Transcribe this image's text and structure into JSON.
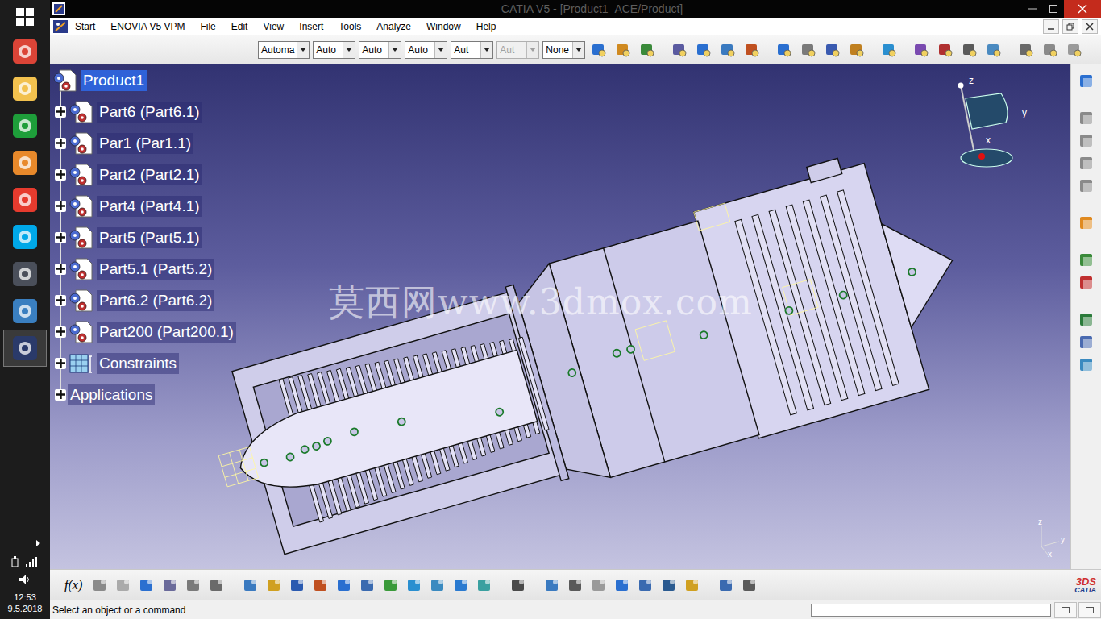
{
  "window": {
    "title": "CATIA V5 - [Product1_ACE/Product]"
  },
  "taskbar": {
    "time": "12:53",
    "date": "9.5.2018"
  },
  "menu": [
    {
      "label": "Start",
      "mnemonic": true
    },
    {
      "label": "ENOVIA V5 VPM",
      "mnemonic": false
    },
    {
      "label": "File",
      "mnemonic": true
    },
    {
      "label": "Edit",
      "mnemonic": true
    },
    {
      "label": "View",
      "mnemonic": true
    },
    {
      "label": "Insert",
      "mnemonic": true
    },
    {
      "label": "Tools",
      "mnemonic": true
    },
    {
      "label": "Analyze",
      "mnemonic": true
    },
    {
      "label": "Window",
      "mnemonic": true
    },
    {
      "label": "Help",
      "mnemonic": true
    }
  ],
  "toolbar": {
    "dropdowns": [
      {
        "value": "Automa",
        "disabled": false
      },
      {
        "value": "Auto",
        "disabled": false
      },
      {
        "value": "Auto",
        "disabled": false
      },
      {
        "value": "Auto",
        "disabled": false
      },
      {
        "value": "Aut",
        "disabled": false
      },
      {
        "value": "Aut",
        "disabled": true
      },
      {
        "value": "None",
        "disabled": false
      }
    ]
  },
  "tree": {
    "items": [
      {
        "label": "Product1",
        "kind": "product",
        "depth": 0,
        "selected": true,
        "expanded": true
      },
      {
        "label": "Part6 (Part6.1)",
        "kind": "part",
        "depth": 1,
        "selected": false,
        "expanded": false
      },
      {
        "label": "Par1 (Par1.1)",
        "kind": "part",
        "depth": 1,
        "selected": false,
        "expanded": false
      },
      {
        "label": "Part2 (Part2.1)",
        "kind": "part",
        "depth": 1,
        "selected": false,
        "expanded": false
      },
      {
        "label": "Part4 (Part4.1)",
        "kind": "part",
        "depth": 1,
        "selected": false,
        "expanded": false
      },
      {
        "label": "Part5 (Part5.1)",
        "kind": "part",
        "depth": 1,
        "selected": false,
        "expanded": false
      },
      {
        "label": "Part5.1 (Part5.2)",
        "kind": "part",
        "depth": 1,
        "selected": false,
        "expanded": false
      },
      {
        "label": "Part6.2 (Part6.2)",
        "kind": "part",
        "depth": 1,
        "selected": false,
        "expanded": false
      },
      {
        "label": "Part200 (Part200.1)",
        "kind": "part",
        "depth": 1,
        "selected": false,
        "expanded": false
      },
      {
        "label": "Constraints",
        "kind": "constraints",
        "depth": 1,
        "selected": false,
        "expanded": false
      },
      {
        "label": "Applications",
        "kind": "applications",
        "depth": 1,
        "selected": false,
        "expanded": false
      }
    ]
  },
  "viewport": {
    "watermark": "莫西网www.3dmox.com",
    "compass": {
      "axes": [
        "z",
        "y",
        "x"
      ]
    },
    "axis_triad": {
      "axes": [
        "z",
        "y",
        "x"
      ]
    }
  },
  "bottom_toolbar": {
    "formula": "f(x)",
    "logo": {
      "mark": "3DS",
      "name": "CATIA"
    }
  },
  "status_bar": {
    "message": "Select an object or a command",
    "input": ""
  }
}
